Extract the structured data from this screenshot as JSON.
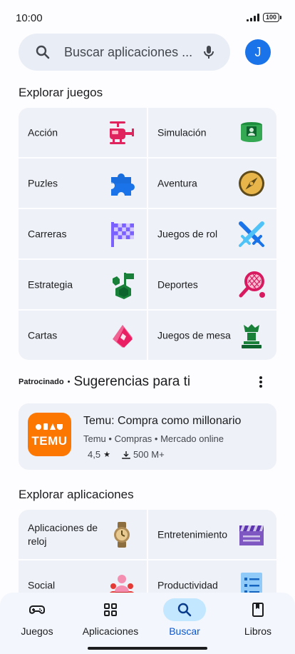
{
  "status_bar": {
    "time": "10:00",
    "battery": "100"
  },
  "search": {
    "placeholder": "Buscar aplicaciones ...",
    "avatar_letter": "J"
  },
  "explore_games": {
    "title": "Explorar juegos",
    "tiles": [
      {
        "label": "Acción",
        "icon": "helicopter-icon"
      },
      {
        "label": "Simulación",
        "icon": "simulation-icon"
      },
      {
        "label": "Puzles",
        "icon": "puzzle-icon"
      },
      {
        "label": "Aventura",
        "icon": "compass-icon"
      },
      {
        "label": "Carreras",
        "icon": "checkered-flag-icon"
      },
      {
        "label": "Juegos de rol",
        "icon": "crossed-swords-icon"
      },
      {
        "label": "Estrategia",
        "icon": "strategy-flag-icon"
      },
      {
        "label": "Deportes",
        "icon": "tennis-racket-icon"
      },
      {
        "label": "Cartas",
        "icon": "cards-icon"
      },
      {
        "label": "Juegos de mesa",
        "icon": "chess-piece-icon"
      }
    ]
  },
  "suggestions": {
    "sponsored": "Patrocinado",
    "separator": "•",
    "title": "Sugerencias para ti",
    "app": {
      "logo_text": "TEMU",
      "name": "Temu: Compra como millonario",
      "meta": "Temu • Compras • Mercado online",
      "rating": "4,5",
      "downloads": "500 M+"
    }
  },
  "explore_apps": {
    "title": "Explorar aplicaciones",
    "tiles": [
      {
        "label": "Aplicaciones de reloj",
        "icon": "watch-icon"
      },
      {
        "label": "Entretenimiento",
        "icon": "clapperboard-icon"
      },
      {
        "label": "Social",
        "icon": "people-icon"
      },
      {
        "label": "Productividad",
        "icon": "checklist-icon"
      }
    ]
  },
  "bottom_nav": {
    "items": [
      {
        "label": "Juegos",
        "icon": "gamepad-icon"
      },
      {
        "label": "Aplicaciones",
        "icon": "apps-grid-icon"
      },
      {
        "label": "Buscar",
        "icon": "search-icon",
        "active": true
      },
      {
        "label": "Libros",
        "icon": "book-icon"
      }
    ]
  },
  "colors": {
    "accent": "#0b57d0",
    "active_pill": "#c2e7ff",
    "tile_bg": "#eef1f7",
    "temu_orange": "#fb7701"
  }
}
